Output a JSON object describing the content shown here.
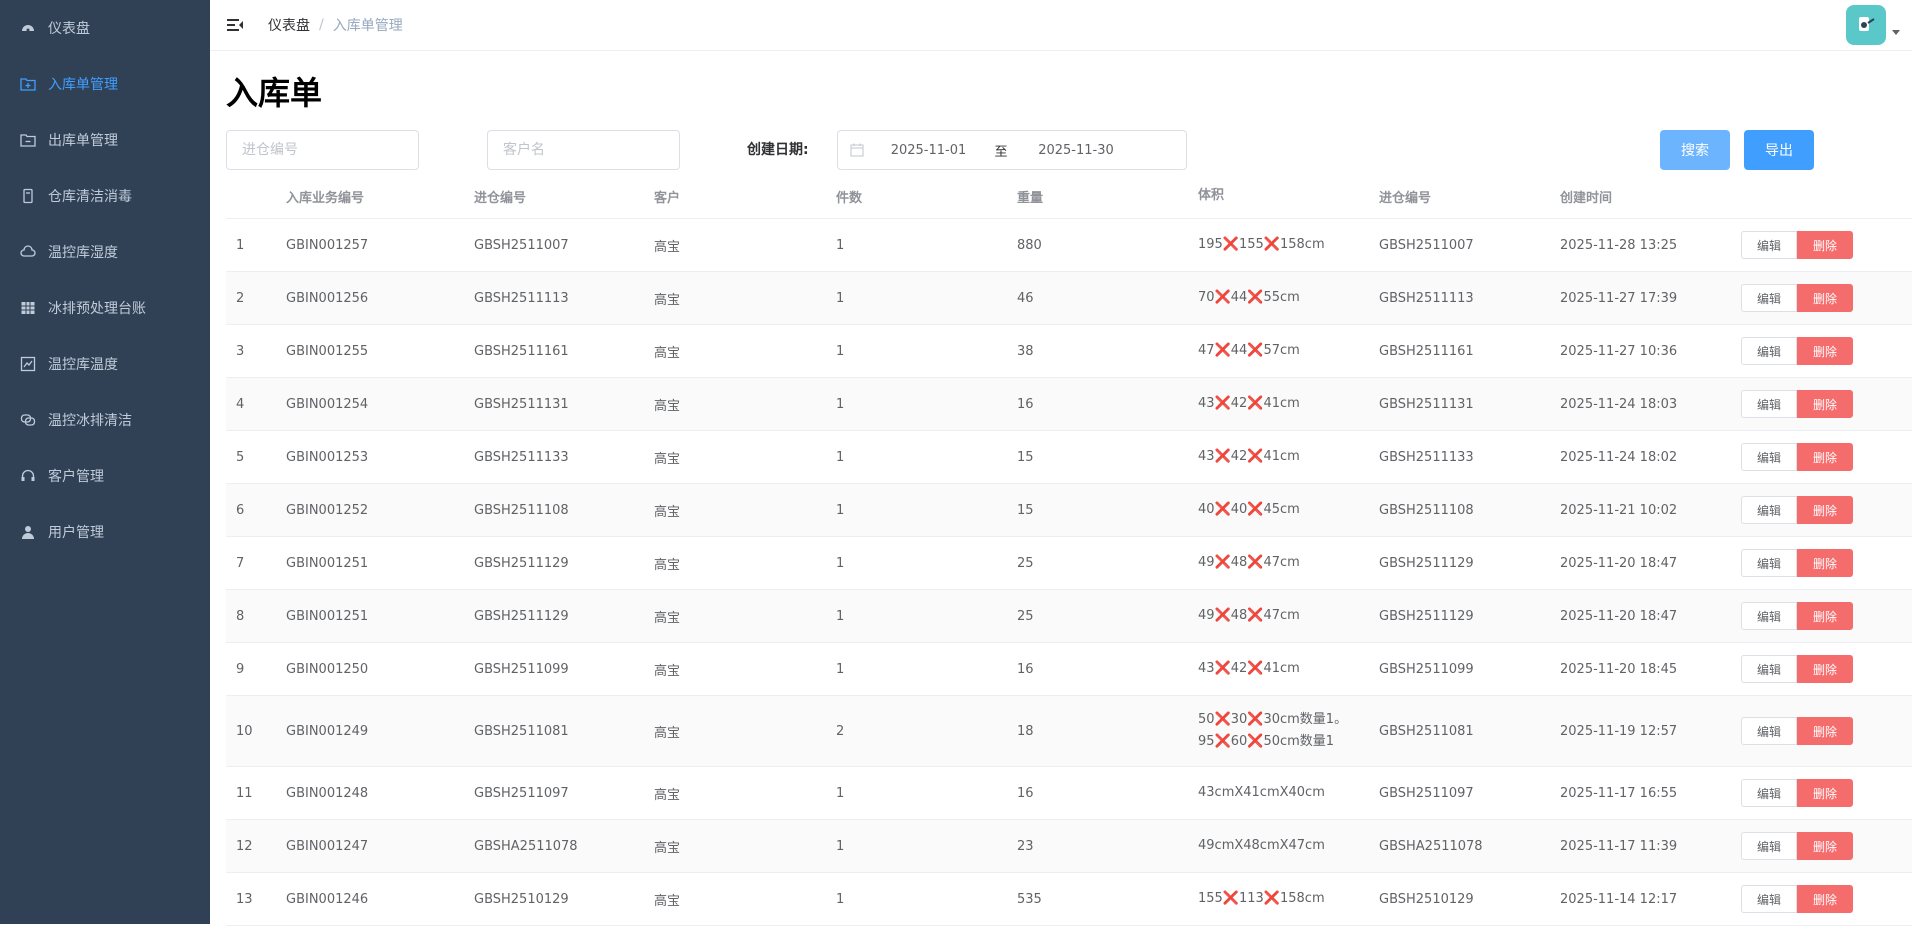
{
  "sidebar": {
    "items": [
      {
        "label": "仪表盘",
        "icon": "dashboard-icon",
        "active": false
      },
      {
        "label": "入库单管理",
        "icon": "folder-in-icon",
        "active": true
      },
      {
        "label": "出库单管理",
        "icon": "folder-out-icon",
        "active": false
      },
      {
        "label": "仓库清洁消毒",
        "icon": "clean-icon",
        "active": false
      },
      {
        "label": "温控库湿度",
        "icon": "cloud-icon",
        "active": false
      },
      {
        "label": "冰排预处理台账",
        "icon": "table-icon",
        "active": false
      },
      {
        "label": "温控库温度",
        "icon": "chart-icon",
        "active": false
      },
      {
        "label": "温控冰排清洁",
        "icon": "loop-icon",
        "active": false
      },
      {
        "label": "客户管理",
        "icon": "headset-icon",
        "active": false
      },
      {
        "label": "用户管理",
        "icon": "user-icon",
        "active": false
      }
    ]
  },
  "navbar": {
    "breadcrumb_home": "仪表盘",
    "breadcrumb_sep": "/",
    "breadcrumb_current": "入库单管理"
  },
  "page": {
    "title": "入库单"
  },
  "filters": {
    "inbound_no_placeholder": "进仓编号",
    "customer_placeholder": "客户名",
    "date_label": "创建日期:",
    "date_start": "2025-11-01",
    "date_sep": "至",
    "date_end": "2025-11-30",
    "search_label": "搜索",
    "export_label": "导出"
  },
  "table": {
    "headers": [
      "",
      "入库业务编号",
      "进仓编号",
      "客户",
      "件数",
      "重量",
      "体积",
      "进仓编号",
      "创建时间",
      ""
    ],
    "edit_label": "编辑",
    "delete_label": "删除",
    "rows": [
      {
        "idx": "1",
        "biz_no": "GBIN001257",
        "in_no": "GBSH2511007",
        "customer": "高宝",
        "count": "1",
        "weight": "880",
        "volume": [
          "195❌155❌158cm"
        ],
        "in_no2": "GBSH2511007",
        "created": "2025-11-28 13:25"
      },
      {
        "idx": "2",
        "biz_no": "GBIN001256",
        "in_no": "GBSH2511113",
        "customer": "高宝",
        "count": "1",
        "weight": "46",
        "volume": [
          "70❌44❌55cm"
        ],
        "in_no2": "GBSH2511113",
        "created": "2025-11-27 17:39"
      },
      {
        "idx": "3",
        "biz_no": "GBIN001255",
        "in_no": "GBSH2511161",
        "customer": "高宝",
        "count": "1",
        "weight": "38",
        "volume": [
          "47❌44❌57cm"
        ],
        "in_no2": "GBSH2511161",
        "created": "2025-11-27 10:36"
      },
      {
        "idx": "4",
        "biz_no": "GBIN001254",
        "in_no": "GBSH2511131",
        "customer": "高宝",
        "count": "1",
        "weight": "16",
        "volume": [
          "43❌42❌41cm"
        ],
        "in_no2": "GBSH2511131",
        "created": "2025-11-24 18:03"
      },
      {
        "idx": "5",
        "biz_no": "GBIN001253",
        "in_no": "GBSH2511133",
        "customer": "高宝",
        "count": "1",
        "weight": "15",
        "volume": [
          "43❌42❌41cm"
        ],
        "in_no2": "GBSH2511133",
        "created": "2025-11-24 18:02"
      },
      {
        "idx": "6",
        "biz_no": "GBIN001252",
        "in_no": "GBSH2511108",
        "customer": "高宝",
        "count": "1",
        "weight": "15",
        "volume": [
          "40❌40❌45cm"
        ],
        "in_no2": "GBSH2511108",
        "created": "2025-11-21 10:02"
      },
      {
        "idx": "7",
        "biz_no": "GBIN001251",
        "in_no": "GBSH2511129",
        "customer": "高宝",
        "count": "1",
        "weight": "25",
        "volume": [
          "49❌48❌47cm"
        ],
        "in_no2": "GBSH2511129",
        "created": "2025-11-20 18:47"
      },
      {
        "idx": "8",
        "biz_no": "GBIN001251",
        "in_no": "GBSH2511129",
        "customer": "高宝",
        "count": "1",
        "weight": "25",
        "volume": [
          "49❌48❌47cm"
        ],
        "in_no2": "GBSH2511129",
        "created": "2025-11-20 18:47"
      },
      {
        "idx": "9",
        "biz_no": "GBIN001250",
        "in_no": "GBSH2511099",
        "customer": "高宝",
        "count": "1",
        "weight": "16",
        "volume": [
          "43❌42❌41cm"
        ],
        "in_no2": "GBSH2511099",
        "created": "2025-11-20 18:45"
      },
      {
        "idx": "10",
        "biz_no": "GBIN001249",
        "in_no": "GBSH2511081",
        "customer": "高宝",
        "count": "2",
        "weight": "18",
        "volume": [
          "50❌30❌30cm数量1。",
          "95❌60❌50cm数量1"
        ],
        "in_no2": "GBSH2511081",
        "created": "2025-11-19 12:57"
      },
      {
        "idx": "11",
        "biz_no": "GBIN001248",
        "in_no": "GBSH2511097",
        "customer": "高宝",
        "count": "1",
        "weight": "16",
        "volume": [
          "43cmX41cmX40cm"
        ],
        "in_no2": "GBSH2511097",
        "created": "2025-11-17 16:55"
      },
      {
        "idx": "12",
        "biz_no": "GBIN001247",
        "in_no": "GBSHA2511078",
        "customer": "高宝",
        "count": "1",
        "weight": "23",
        "volume": [
          "49cmX48cmX47cm"
        ],
        "in_no2": "GBSHA2511078",
        "created": "2025-11-17 11:39"
      },
      {
        "idx": "13",
        "biz_no": "GBIN001246",
        "in_no": "GBSH2510129",
        "customer": "高宝",
        "count": "1",
        "weight": "535",
        "volume": [
          "155❌113❌158cm"
        ],
        "in_no2": "GBSH2510129",
        "created": "2025-11-14 12:17"
      }
    ]
  },
  "colors": {
    "sidebar_bg": "#304156",
    "sidebar_text": "#bfcbd9",
    "accent": "#409eff",
    "danger": "#f56c6c"
  }
}
